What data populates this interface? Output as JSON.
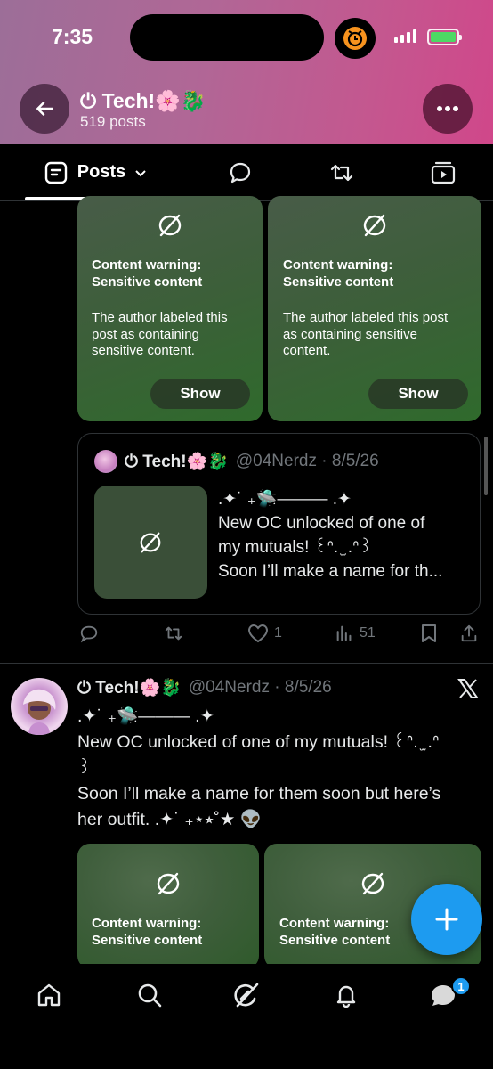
{
  "status_bar": {
    "time": "7:35"
  },
  "profile": {
    "name": "⏻ Tech!🌸🐉",
    "post_count": "519 posts"
  },
  "tabs": [
    {
      "label": "Posts"
    }
  ],
  "top_media": [
    {
      "title_line1": "Content warning:",
      "title_line2": "Sensitive content",
      "desc_line1": "The author labeled this",
      "desc_line2": "post as containing",
      "desc_line3": "sensitive content.",
      "button": "Show"
    },
    {
      "title_line1": "Content warning:",
      "title_line2": "Sensitive content",
      "desc_line1": "The author labeled this post",
      "desc_line2": "as containing sensitive",
      "desc_line3": "content.",
      "button": "Show"
    }
  ],
  "quote": {
    "name": "⏻ Tech!🌸🐉",
    "handle": "@04Nerdz · 8/5/26",
    "line1": ".✦˙ ₊🛸——— .✦",
    "line2": "New OC unlocked of one of",
    "line3": "my mutuals! ꒰ᐢ. ̫ .ᐢ꒱",
    "line4": "Soon I’ll make a name for th..."
  },
  "actions": {
    "likes": "1",
    "views": "51"
  },
  "post2": {
    "name": "⏻ Tech!🌸🐉",
    "handle": "@04Nerdz · 8/5/26",
    "line1": ".✦˙ ₊🛸——— .✦",
    "line2": "New OC unlocked of one of my mutuals! ꒰ᐢ. ̫ .ᐢ",
    "line3": "꒱",
    "line4": "Soon I’ll make a name for them soon but here’s",
    "line5": "her outfit. .✦˙ ₊⋆⭒˚★ 👽"
  },
  "bottom_media": [
    {
      "title_line1": "Content warning:",
      "title_line2": "Sensitive content"
    },
    {
      "title_line1": "Content warning:",
      "title_line2": "Sensitive content"
    }
  ],
  "nav": {
    "messages_badge": "1"
  },
  "colors": {
    "accent": "#1d9bf0",
    "header_start": "#9c6e98",
    "header_end": "#d0478a"
  }
}
